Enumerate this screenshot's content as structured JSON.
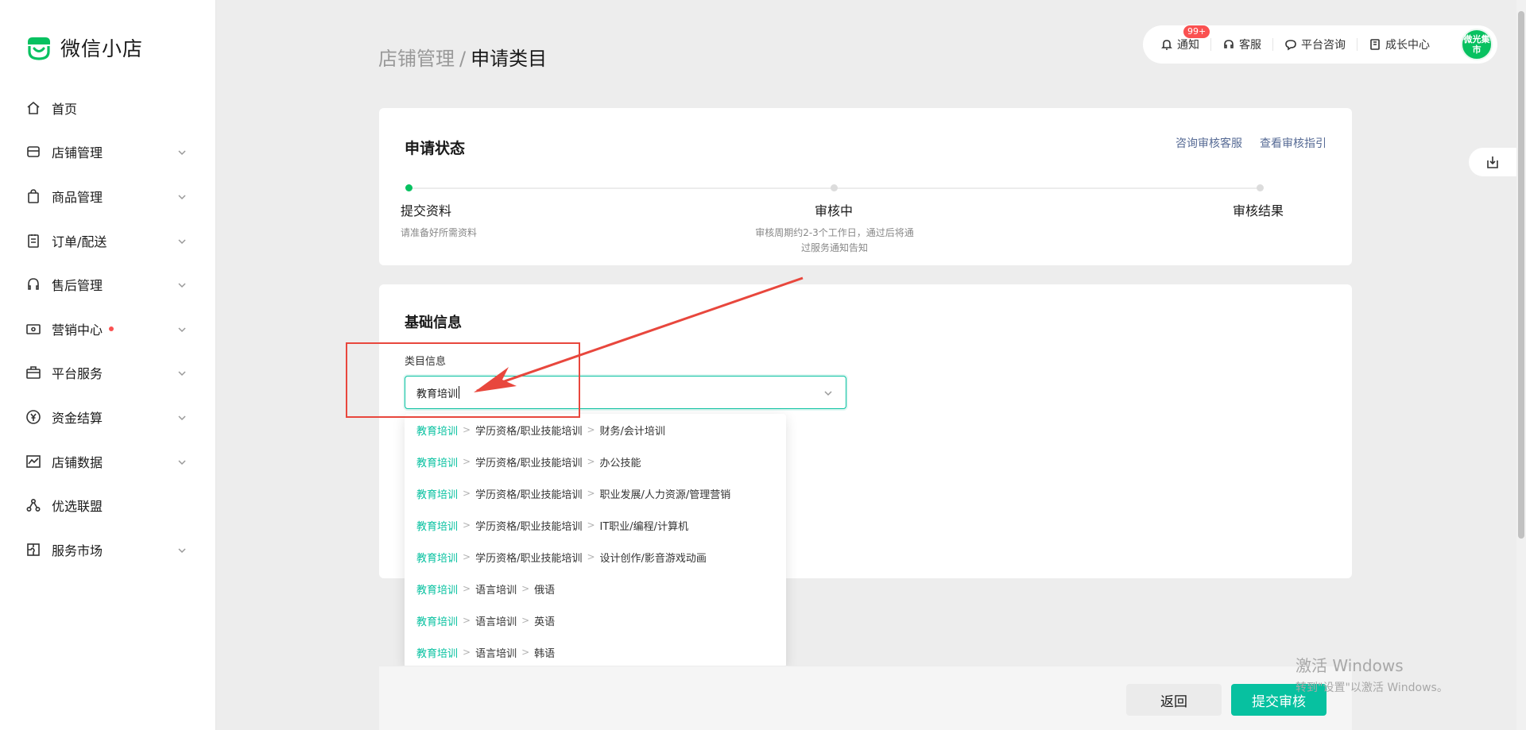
{
  "app": {
    "logo_text": "微信小店"
  },
  "sidebar": {
    "items": [
      {
        "label": "首页",
        "icon": "home-icon",
        "has_chevron": false
      },
      {
        "label": "店铺管理",
        "icon": "store-icon",
        "has_chevron": true
      },
      {
        "label": "商品管理",
        "icon": "bag-icon",
        "has_chevron": true
      },
      {
        "label": "订单/配送",
        "icon": "order-icon",
        "has_chevron": true
      },
      {
        "label": "售后管理",
        "icon": "headset-icon",
        "has_chevron": true
      },
      {
        "label": "营销中心",
        "icon": "ticket-icon",
        "has_chevron": true,
        "dot": true
      },
      {
        "label": "平台服务",
        "icon": "briefcase-icon",
        "has_chevron": true
      },
      {
        "label": "资金结算",
        "icon": "yen-icon",
        "has_chevron": true
      },
      {
        "label": "店铺数据",
        "icon": "chart-icon",
        "has_chevron": true
      },
      {
        "label": "优选联盟",
        "icon": "network-icon",
        "has_chevron": false
      },
      {
        "label": "服务市场",
        "icon": "puzzle-icon",
        "has_chevron": true
      }
    ]
  },
  "breadcrumb": {
    "parent": "店铺管理",
    "separator": "/",
    "current": "申请类目"
  },
  "topbar": {
    "notify": "通知",
    "notify_badge": "99+",
    "service": "客服",
    "consult": "平台咨询",
    "growth": "成长中心",
    "avatar_text": "微光集市"
  },
  "status_card": {
    "title": "申请状态",
    "link_consult": "咨询审核客服",
    "link_guide": "查看审核指引",
    "steps": [
      {
        "title": "提交资料",
        "desc": "请准备好所需资料"
      },
      {
        "title": "审核中",
        "desc": "审核周期约2-3个工作日，通过后将通过服务通知告知"
      },
      {
        "title": "审核结果",
        "desc": ""
      }
    ]
  },
  "basic_card": {
    "title": "基础信息",
    "field_label": "类目信息",
    "field_value": "教育培训"
  },
  "dropdown": {
    "items": [
      {
        "parts": [
          "教育培训",
          "学历资格/职业技能培训",
          "财务/会计培训"
        ]
      },
      {
        "parts": [
          "教育培训",
          "学历资格/职业技能培训",
          "办公技能"
        ]
      },
      {
        "parts": [
          "教育培训",
          "学历资格/职业技能培训",
          "职业发展/人力资源/管理营销"
        ]
      },
      {
        "parts": [
          "教育培训",
          "学历资格/职业技能培训",
          "IT职业/编程/计算机"
        ]
      },
      {
        "parts": [
          "教育培训",
          "学历资格/职业技能培训",
          "设计创作/影音游戏动画"
        ]
      },
      {
        "parts": [
          "教育培训",
          "语言培训",
          "俄语"
        ]
      },
      {
        "parts": [
          "教育培训",
          "语言培训",
          "英语"
        ]
      },
      {
        "parts": [
          "教育培训",
          "语言培训",
          "韩语"
        ]
      }
    ]
  },
  "footer": {
    "back": "返回",
    "submit": "提交审核"
  },
  "watermark": {
    "title": "激活 Windows",
    "subtitle": "转到\"设置\"以激活 Windows。"
  },
  "colors": {
    "brand": "#07c160",
    "accent": "#07c1a0",
    "link": "#576b95",
    "annotation": "#e8473d"
  }
}
